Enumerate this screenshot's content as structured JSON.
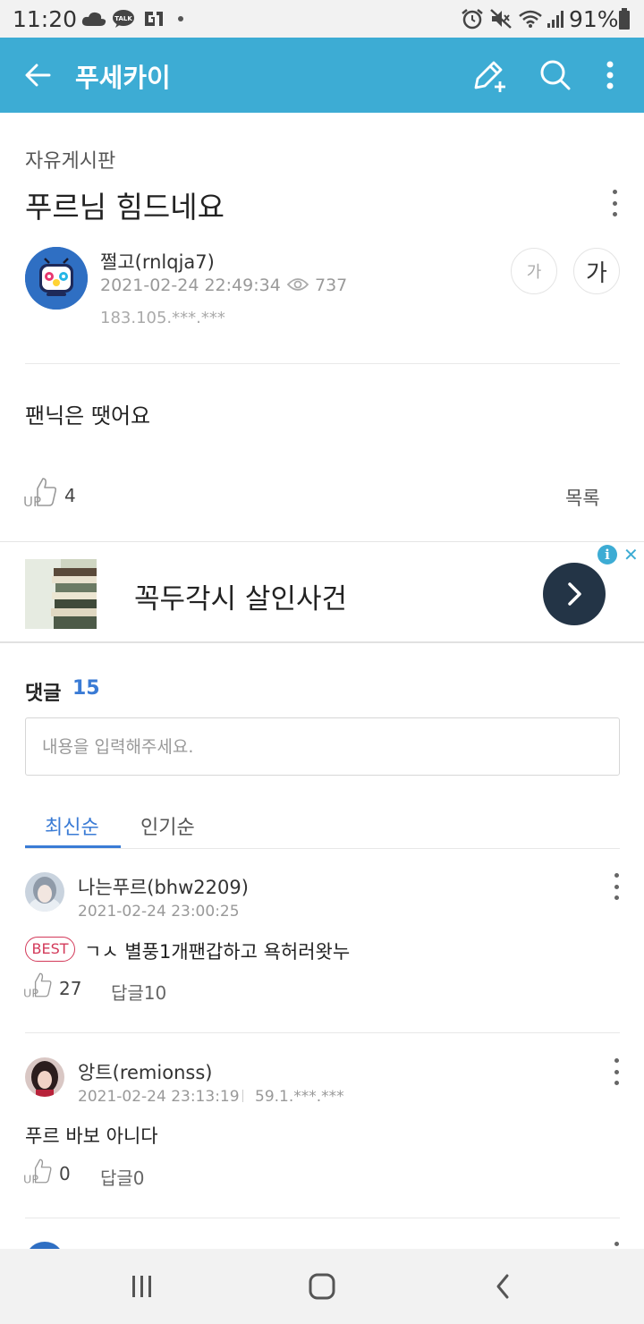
{
  "status_bar": {
    "time": "11:20",
    "battery": "91%",
    "icons": [
      "cloud-icon",
      "talk-icon",
      "g1-icon",
      "dot-icon",
      "alarm-icon",
      "mute-icon",
      "wifi-icon",
      "signal-icon",
      "battery-icon"
    ],
    "talk_label": "TALK"
  },
  "app_bar": {
    "title": "푸세카이",
    "background": "#3dacd4",
    "icons": [
      "back-arrow-icon",
      "compose-icon",
      "search-icon",
      "more-vert-icon"
    ]
  },
  "post": {
    "board": "자유게시판",
    "title": "푸르님 힘드네요",
    "author": "쩔고(rnlqja7)",
    "date": "2021-02-24 22:49:34",
    "views": "737",
    "ip": "183.105.***.***",
    "font_small": "가",
    "font_large": "가",
    "body": "팬닉은 땟어요",
    "likes": "4",
    "list_label": "목록"
  },
  "ad": {
    "text": "꼭두각시 살인사건",
    "info_label": "i",
    "close_label": "✕"
  },
  "comments": {
    "label": "댓글",
    "count": "15",
    "input_placeholder": "내용을 입력해주세요.",
    "tabs": [
      {
        "label": "최신순",
        "active": true
      },
      {
        "label": "인기순",
        "active": false
      }
    ],
    "accent": "#3a7bd5",
    "items": [
      {
        "name": "나는푸르(bhw2209)",
        "date": "2021-02-24 23:00:25",
        "ip": "",
        "best": "BEST",
        "text": "ㄱㅅ 별풍1개팬갑하고 욕허러왓누",
        "likes": "27",
        "reply": "답글10"
      },
      {
        "name": "앙트(remionss)",
        "date": "2021-02-24 23:13:19",
        "ip": "59.1.***.***",
        "best": "",
        "text": "푸르 바보 아니다",
        "likes": "0",
        "reply": "답글0"
      }
    ]
  },
  "nav_bar": {
    "icons": [
      "recent-apps-icon",
      "home-icon",
      "back-icon"
    ]
  }
}
